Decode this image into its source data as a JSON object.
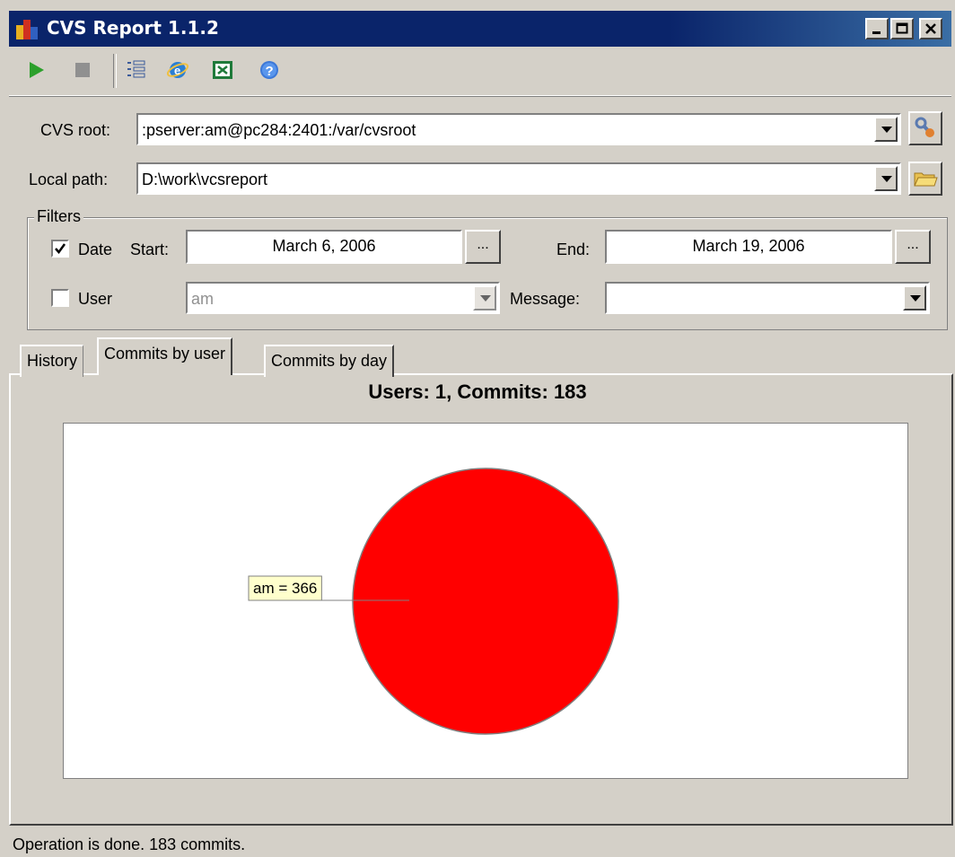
{
  "window": {
    "title": "CVS Report 1.1.2"
  },
  "toolbar": {
    "icons": [
      "play-icon",
      "stop-icon",
      "list-icon",
      "browser-icon",
      "excel-icon",
      "help-icon"
    ]
  },
  "form": {
    "cvs_root_label": "CVS root:",
    "cvs_root_value": ":pserver:am@pc284:2401:/var/cvsroot",
    "local_path_label": "Local path:",
    "local_path_value": "D:\\work\\vcsreport"
  },
  "filters": {
    "legend": "Filters",
    "date_label": "Date",
    "date_checked": true,
    "start_label": "Start:",
    "start_value": "March 6, 2006",
    "end_label": "End:",
    "end_value": "March 19, 2006",
    "ellipsis": "...",
    "user_label": "User",
    "user_checked": false,
    "user_value": "am",
    "message_label": "Message:",
    "message_value": ""
  },
  "tabs": [
    {
      "label": "History",
      "active": false
    },
    {
      "label": "Commits by user",
      "active": true
    },
    {
      "label": "Commits by day",
      "active": false
    }
  ],
  "chart_data": {
    "type": "pie",
    "title": "Users: 1, Commits: 183",
    "slices": [
      {
        "label": "am = 366",
        "name": "am",
        "value": 366,
        "color": "#ff0000"
      }
    ]
  },
  "status": {
    "text": "Operation is done. 183 commits."
  },
  "colors": {
    "titlebar": "#0a246a",
    "face": "#d4d0c8",
    "slice": "#ff0000",
    "label_bg": "#ffffcc"
  }
}
